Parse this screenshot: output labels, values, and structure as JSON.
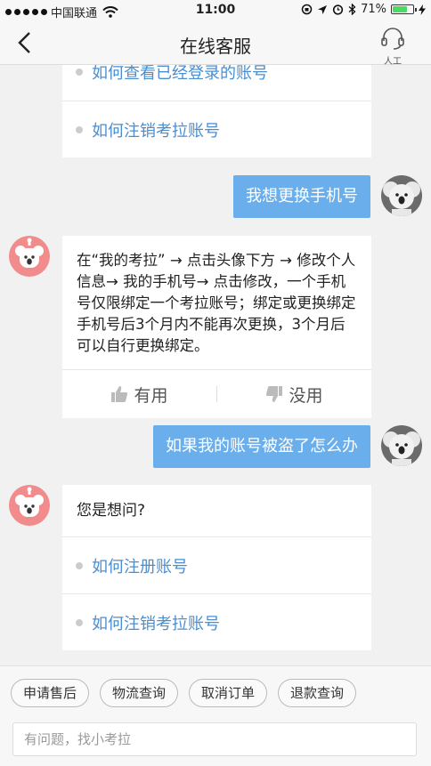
{
  "status": {
    "carrier": "中国联通",
    "time": "11:00",
    "battery": "71%",
    "battery_level": 0.71
  },
  "nav": {
    "title": "在线客服",
    "service_label": "人工"
  },
  "messages": {
    "card1_options": [
      "如何查看已经登录的账号",
      "如何注销考拉账号"
    ],
    "user1": "我想更换手机号",
    "bot1": "在“我的考拉” → 点击头像下方 → 修改个人信息→ 我的手机号→ 点击修改，一个手机号仅限绑定一个考拉账号；绑定或更换绑定手机号后3个月内不能再次更换，3个月后可以自行更换绑定。",
    "useful": "有用",
    "useless": "没用",
    "user2": "如果我的账号被盗了怎么办",
    "bot2_title": "您是想问?",
    "bot2_options": [
      "如何注册账号",
      "如何注销考拉账号"
    ]
  },
  "quick_actions": [
    "申请售后",
    "物流查询",
    "取消订单",
    "退款查询"
  ],
  "input": {
    "placeholder": "有问题，找小考拉"
  },
  "colors": {
    "user_bubble": "#6aaeec",
    "link": "#4a8ed0",
    "battery": "#4cd964"
  }
}
